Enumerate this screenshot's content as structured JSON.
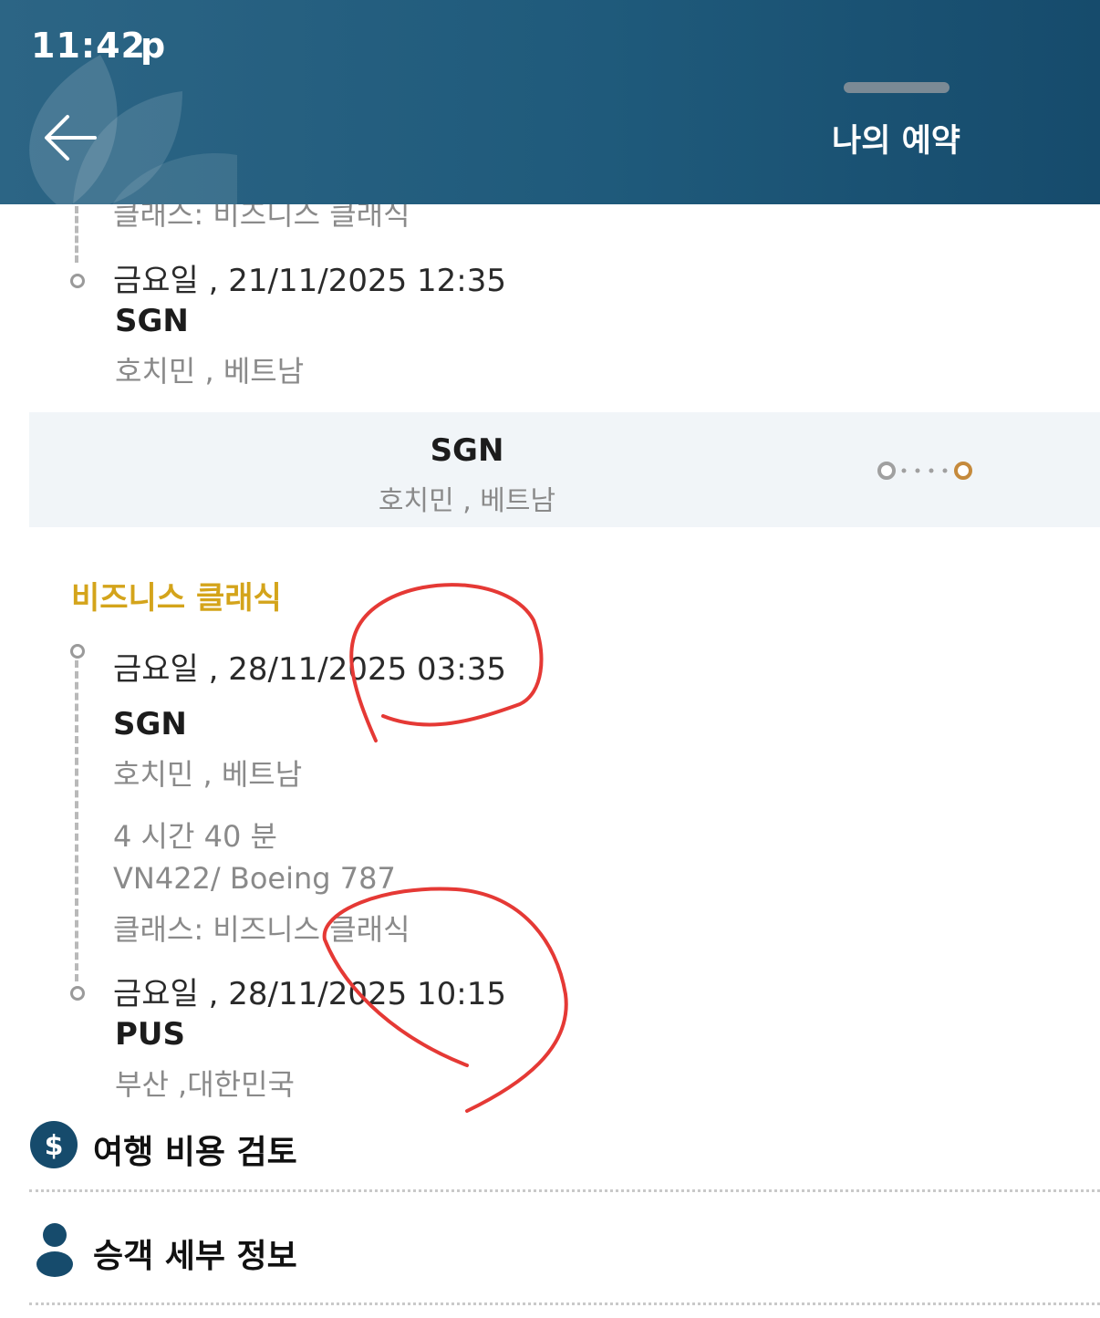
{
  "status_bar": {
    "time": "11:42",
    "indicator": "p"
  },
  "header": {
    "title": "나의 예약",
    "back_icon": "arrow-left-icon"
  },
  "prev_segment": {
    "class_partial": "클래스: 비즈니스 클래식",
    "arrival_date": "금요일 , 21/11/2025 12:35",
    "arrival_code": "SGN",
    "arrival_city": "호치민 , 베트남"
  },
  "stopover": {
    "code": "SGN",
    "city": "호치민 , 베트남"
  },
  "segment": {
    "class_title": "비즈니스 클래식",
    "departure_date": "금요일 , 28/11/2025 03:35",
    "departure_code": "SGN",
    "departure_city": "호치민 , 베트남",
    "duration": "4 시간 40 분",
    "flight": "VN422/ Boeing 787",
    "class_line": "클래스: 비즈니스 클래식",
    "arrival_date": "금요일 , 28/11/2025 10:15",
    "arrival_code": "PUS",
    "arrival_city": "부산 ,대한민국"
  },
  "sections": [
    {
      "label": "여행 비용 검토",
      "icon": "dollar-icon"
    },
    {
      "label": "승객 세부 정보",
      "icon": "person-icon"
    }
  ],
  "colors": {
    "header": "#1f5a7b",
    "accent_gold": "#d4a41b",
    "icon_teal": "#164b6c",
    "annotation_red": "#e53935"
  }
}
